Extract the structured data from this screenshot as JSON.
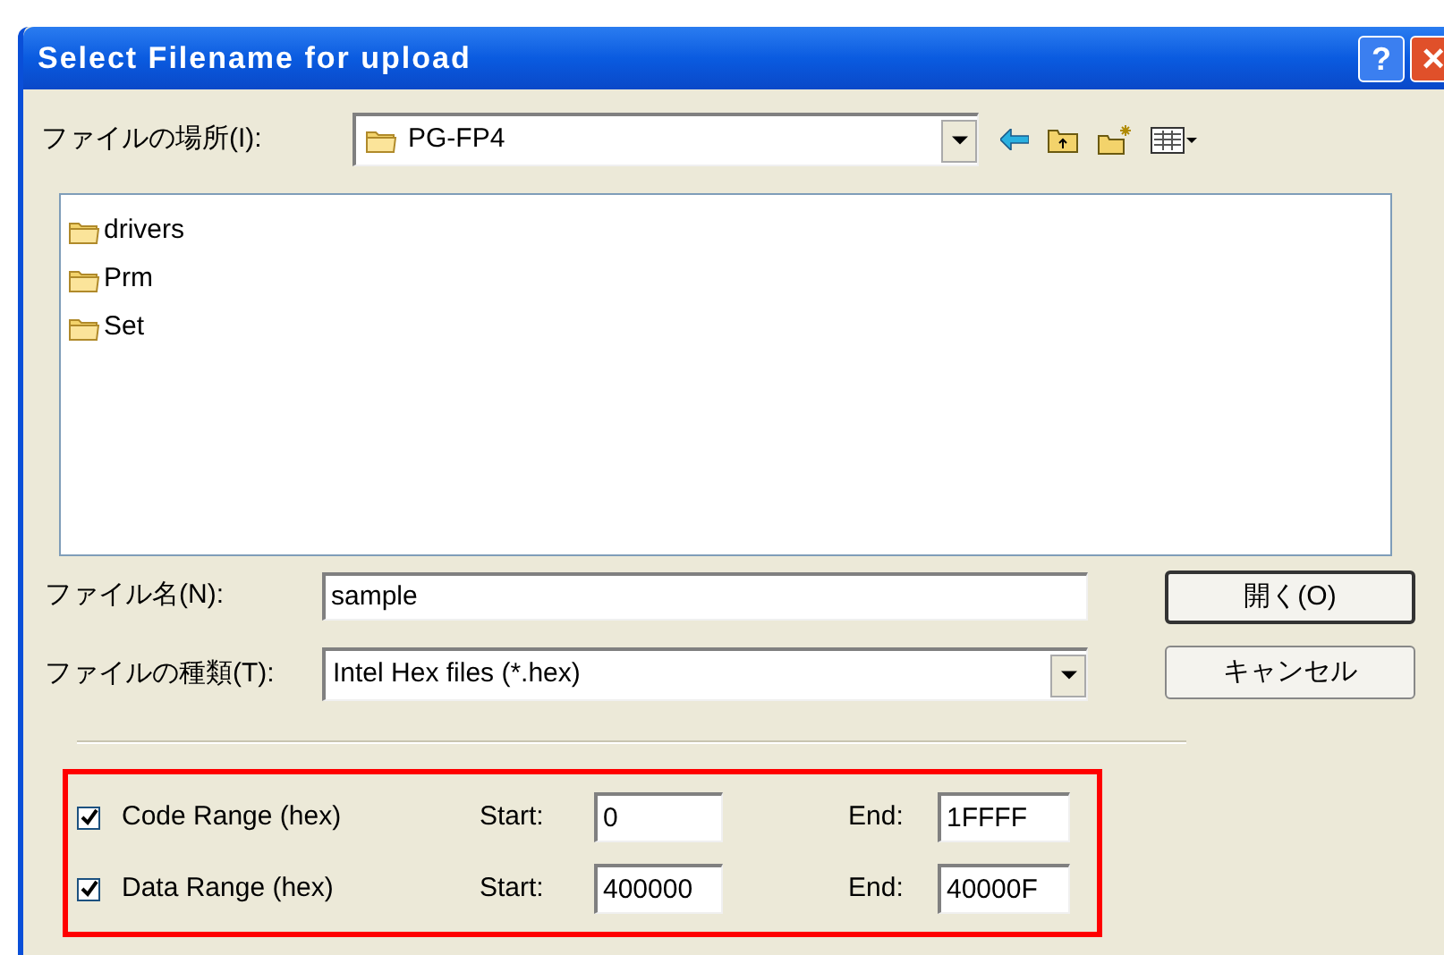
{
  "window": {
    "title": "Select Filename for upload",
    "buttons": [
      "?",
      "×"
    ]
  },
  "location": {
    "label": "ファイルの場所(I):",
    "value": "PG-FP4"
  },
  "files": [
    {
      "name": "drivers"
    },
    {
      "name": "Prm"
    },
    {
      "name": "Set"
    }
  ],
  "filename": {
    "label": "ファイル名(N):",
    "value": "sample"
  },
  "filetype": {
    "label": "ファイルの種類(T):",
    "value": "Intel Hex files (*.hex)"
  },
  "actions": [
    "開く(O)",
    "キャンセル"
  ],
  "ranges": [
    {
      "label": "Code Range (hex)",
      "checked": true,
      "start_label": "Start:",
      "start": "0",
      "end_label": "End:",
      "end": "1FFFF"
    },
    {
      "label": "Data Range (hex)",
      "checked": true,
      "start_label": "Start:",
      "start": "400000",
      "end_label": "End:",
      "end": "40000F"
    }
  ]
}
